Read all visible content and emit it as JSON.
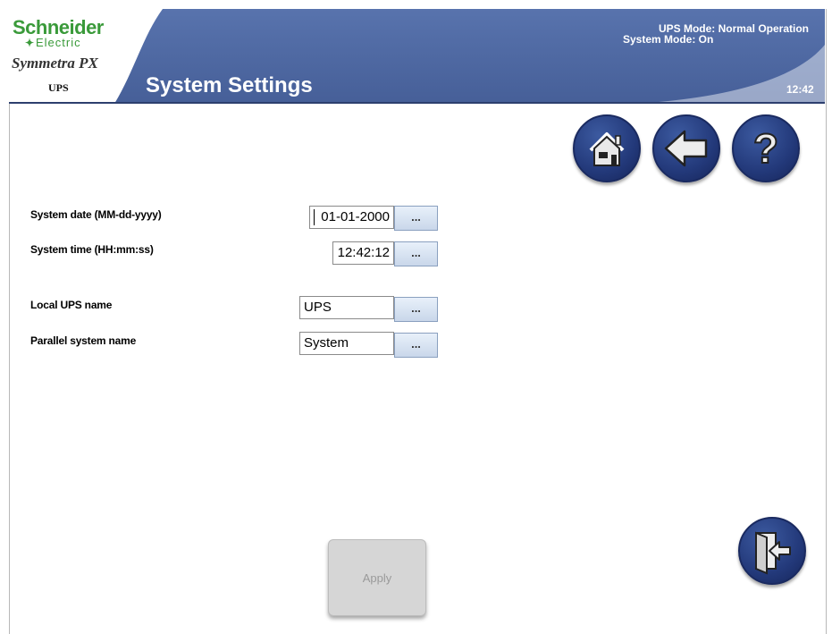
{
  "header": {
    "brand": "Schneider",
    "brand_sub": "Electric",
    "product": "Symmetra PX",
    "device": "UPS",
    "title": "System Settings",
    "ups_mode": "UPS Mode: Normal Operation",
    "system_mode": "System Mode: On",
    "clock": "12:42"
  },
  "colors": {
    "header_blue": "#4f6aa4",
    "brand_green": "#3a9a3a",
    "button_blue": "#23397a"
  },
  "nav": {
    "home_icon": "home-icon",
    "back_icon": "arrow-left-icon",
    "help_icon": "help-icon",
    "logout_icon": "exit-door-icon"
  },
  "form": {
    "system_date": {
      "label": "System date (MM-dd-yyyy)",
      "value": "01-01-2000"
    },
    "system_time": {
      "label": "System time (HH:mm:ss)",
      "value": "12:42:12"
    },
    "local_ups_name": {
      "label": "Local UPS name",
      "value": "UPS"
    },
    "parallel_system_name": {
      "label": "Parallel system name",
      "value": "System"
    },
    "edit_button_label": "...",
    "apply_label": "Apply"
  }
}
